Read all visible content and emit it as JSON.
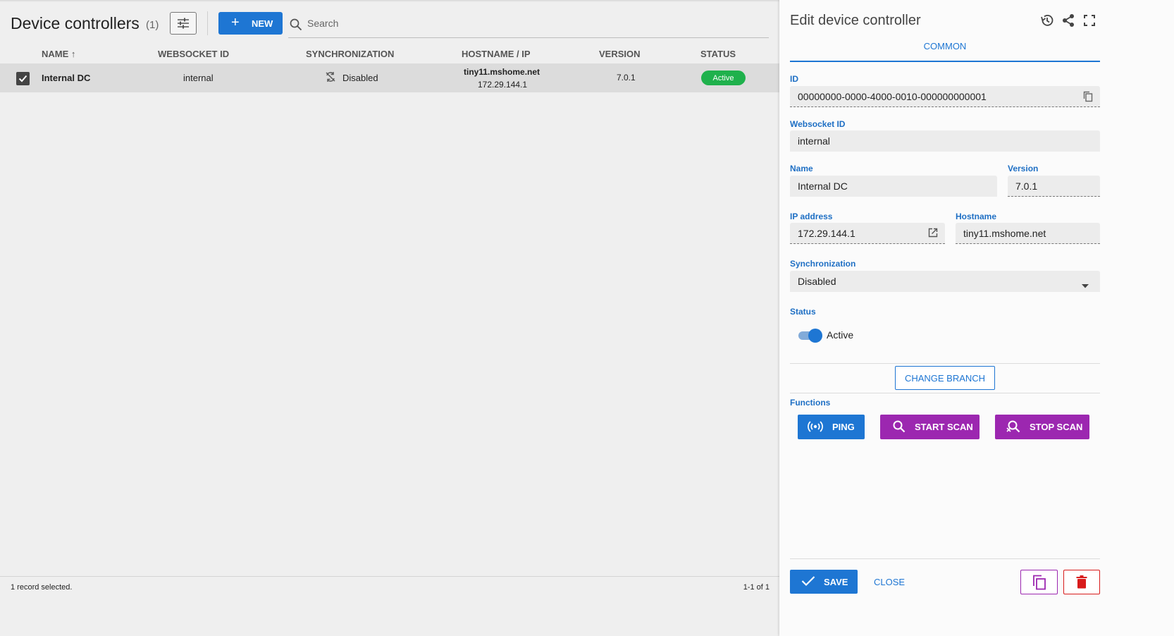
{
  "header": {
    "title": "Device controllers",
    "count": "(1)",
    "new_label": "NEW",
    "search_placeholder": "Search"
  },
  "table": {
    "columns": [
      "NAME",
      "WEBSOCKET ID",
      "SYNCHRONIZATION",
      "HOSTNAME / IP",
      "VERSION",
      "STATUS"
    ],
    "rows": [
      {
        "name": "Internal DC",
        "websocket_id": "internal",
        "synchronization": "Disabled",
        "hostname": "tiny11.mshome.net",
        "ip": "172.29.144.1",
        "version": "7.0.1",
        "status": "Active"
      }
    ]
  },
  "footer": {
    "records_selected": "1 record selected.",
    "pagination": "1-1 of 1"
  },
  "panel": {
    "title": "Edit device controller",
    "tab": "COMMON",
    "fields": {
      "id_label": "ID",
      "id_value": "00000000-0000-4000-0010-000000000001",
      "websocket_label": "Websocket ID",
      "websocket_value": "internal",
      "name_label": "Name",
      "name_value": "Internal DC",
      "version_label": "Version",
      "version_value": "7.0.1",
      "ip_label": "IP address",
      "ip_value": "172.29.144.1",
      "hostname_label": "Hostname",
      "hostname_value": "tiny11.mshome.net",
      "sync_label": "Synchronization",
      "sync_value": "Disabled",
      "status_label": "Status",
      "status_value": "Active"
    },
    "change_branch": "CHANGE BRANCH",
    "functions_label": "Functions",
    "functions": {
      "ping": "PING",
      "start_scan": "START SCAN",
      "stop_scan": "STOP SCAN"
    },
    "save": "SAVE",
    "close": "CLOSE"
  },
  "colors": {
    "primary": "#1e76d3",
    "function_purple": "#9c27b0",
    "status_green": "#1fb14c",
    "delete_red": "#d81b1b"
  }
}
